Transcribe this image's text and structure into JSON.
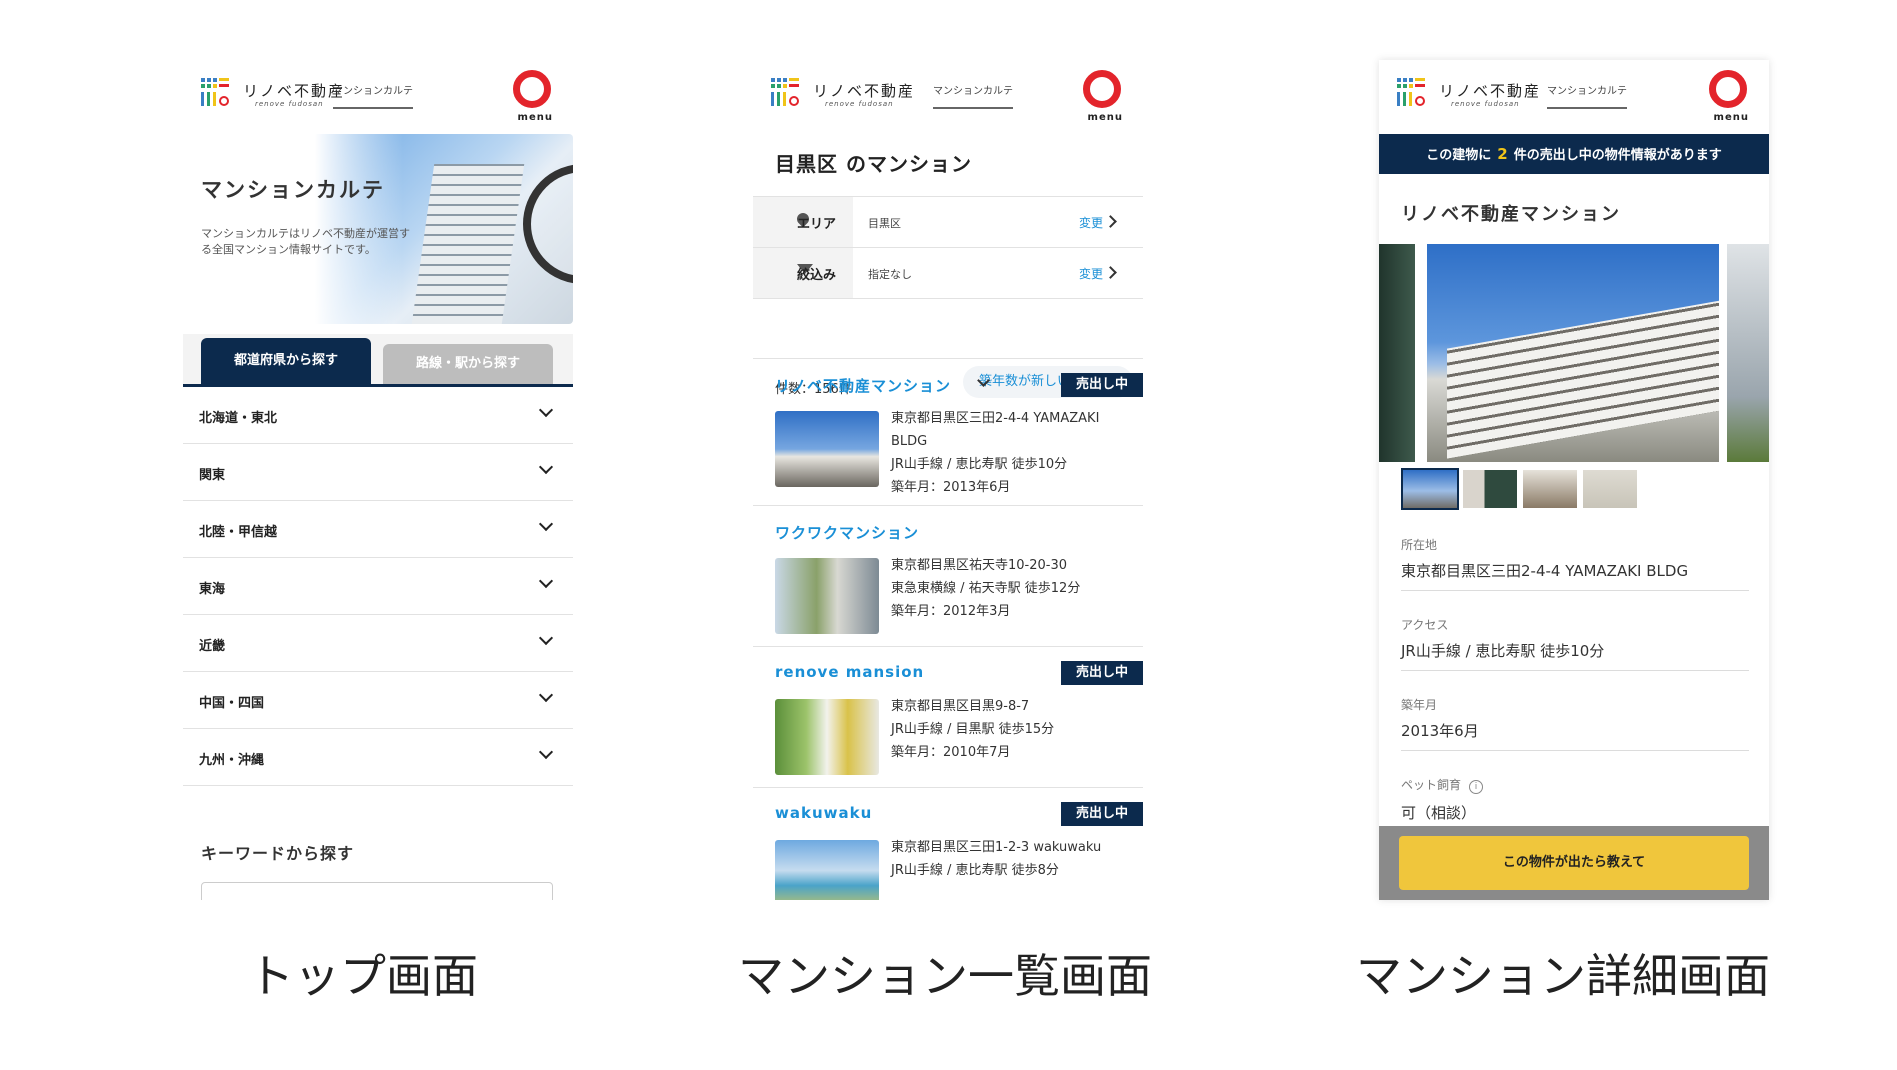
{
  "header": {
    "brand": "リノベ不動産",
    "brand_sub": "renove fudosan",
    "karte_link": "マンションカルテ",
    "menu": "menu"
  },
  "top": {
    "hero_title": "マンションカルテ",
    "hero_desc": "マンションカルテはリノベ不動産が運営する全国マンション情報サイトです。",
    "tab_active": "都道府県から探す",
    "tab_inactive": "路線・駅から探す",
    "regions": [
      "北海道・東北",
      "関東",
      "北陸・甲信越",
      "東海",
      "近畿",
      "中国・四国",
      "九州・沖縄"
    ],
    "keyword_title": "キーワードから探す"
  },
  "list": {
    "page_title": "目黒区 のマンション",
    "filters": [
      {
        "key": "エリア",
        "value": "目黒区",
        "change": "変更"
      },
      {
        "key": "絞込み",
        "value": "指定なし",
        "change": "変更"
      }
    ],
    "count": "件数：156件",
    "sort": "築年数が新しい順",
    "listings": [
      {
        "name": "リノベ不動産マンション",
        "badge": "売出し中",
        "lines": [
          "東京都目黒区三田2-4-4 YAMAZAKI BLDG",
          "JR山手線 / 恵比寿駅 徒歩10分",
          "築年月：2013年6月"
        ]
      },
      {
        "name": "ワクワクマンション",
        "badge": "",
        "lines": [
          "東京都目黒区祐天寺10-20-30",
          "東急東横線 / 祐天寺駅 徒歩12分",
          "築年月：2012年3月"
        ]
      },
      {
        "name": "renove mansion",
        "badge": "売出し中",
        "lines": [
          "東京都目黒区目黒9-8-7",
          "JR山手線 / 目黒駅 徒歩15分",
          "築年月：2010年7月"
        ]
      },
      {
        "name": "wakuwaku",
        "badge": "売出し中",
        "lines": [
          "東京都目黒区三田1-2-3 wakuwaku",
          "JR山手線 / 恵比寿駅 徒歩8分",
          ""
        ]
      }
    ]
  },
  "detail": {
    "banner_pre": "この建物に",
    "banner_num": "2",
    "banner_post": "件の売出し中の物件情報があります",
    "title": "リノベ不動産マンション",
    "fields": [
      {
        "label": "所在地",
        "value": "東京都目黒区三田2-4-4 YAMAZAKI BLDG"
      },
      {
        "label": "アクセス",
        "value": "JR山手線 / 恵比寿駅 徒歩10分"
      },
      {
        "label": "築年月",
        "value": "2013年6月"
      },
      {
        "label": "ペット飼育",
        "value": "可（相談）"
      }
    ],
    "info_icon": "i",
    "cta": "この物件が出たら教えて"
  },
  "captions": [
    "トップ画面",
    "マンション一覧画面",
    "マンション詳細画面"
  ],
  "colors": {
    "navy": "#0c2a4d",
    "link_blue": "#1a8fd6",
    "accent_red": "#e3242b",
    "cta_yellow": "#f0c63c",
    "banner_number": "#f0c419"
  }
}
